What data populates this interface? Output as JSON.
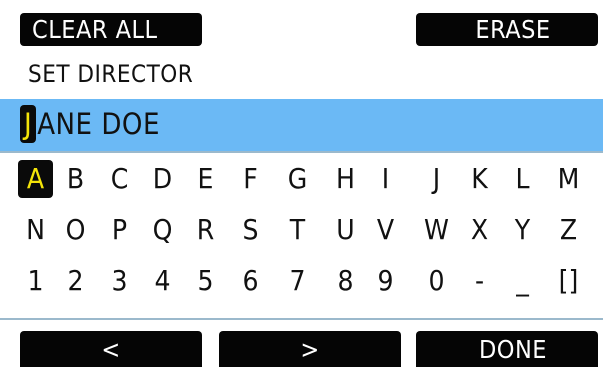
{
  "header": {
    "clear_label": "CLEAR ALL",
    "erase_label": "ERASE"
  },
  "title": "SET DIRECTOR",
  "entry": {
    "cursor_char": "J",
    "rest_text": "ANE DOE",
    "highlight_color": "#6bb9f5"
  },
  "keyboard": {
    "rows": [
      [
        "A",
        "B",
        "C",
        "D",
        "E",
        "F",
        "G",
        "H",
        "I",
        "J",
        "K",
        "L",
        "M"
      ],
      [
        "N",
        "O",
        "P",
        "Q",
        "R",
        "S",
        "T",
        "U",
        "V",
        "W",
        "X",
        "Y",
        "Z"
      ],
      [
        "1",
        "2",
        "3",
        "4",
        "5",
        "6",
        "7",
        "8",
        "9",
        "0",
        "-",
        "_",
        "[]"
      ]
    ],
    "selected": "A",
    "selected_color": "#f4e409"
  },
  "footer": {
    "prev_label": "<",
    "next_label": ">",
    "done_label": "DONE"
  }
}
